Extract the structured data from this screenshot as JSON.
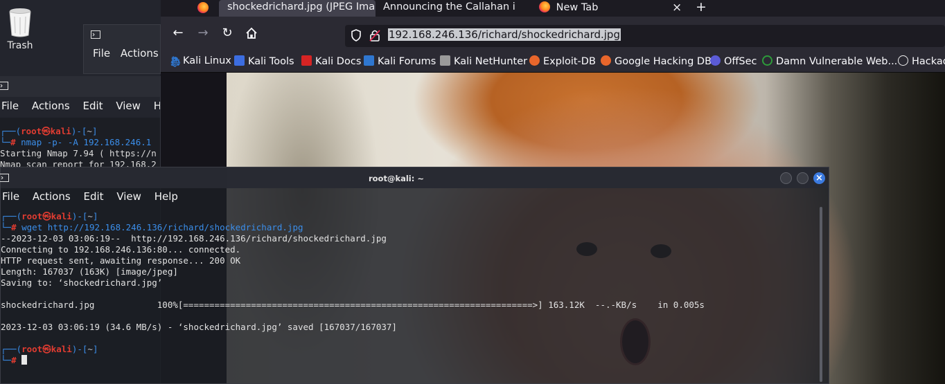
{
  "desktop": {
    "trash_label": "Trash",
    "icons": [
      "trash-icon",
      "terminal-icon",
      "firefox-icon"
    ]
  },
  "bg_terminal_top": {
    "menu": [
      "File",
      "Actions"
    ]
  },
  "bg_terminal_left": {
    "menu": [
      "File",
      "Actions",
      "Edit",
      "View",
      "Help"
    ],
    "prompt_user": "root",
    "prompt_host": "kali",
    "prompt_dir": "~",
    "command": "nmap -p- -A 192.168.246.1",
    "output": [
      "Starting Nmap 7.94 ( https://n",
      "Nmap scan report for 192.168.2"
    ]
  },
  "browser": {
    "tabs": [
      {
        "title": "shockedrichard.jpg (JPEG Ima",
        "active": true
      },
      {
        "title": "Announcing the Callahan inte",
        "active": false
      },
      {
        "title": "New Tab",
        "active": false
      }
    ],
    "url": "192.168.246.136/richard/shockedrichard.jpg",
    "bookmarks": [
      {
        "label": "Kali Linux",
        "icon": "kali-icon",
        "color": "#2f77d0"
      },
      {
        "label": "Kali Tools",
        "icon": "kali-tools-icon",
        "color": "#3c6de0"
      },
      {
        "label": "Kali Docs",
        "icon": "kali-docs-icon",
        "color": "#d62424"
      },
      {
        "label": "Kali Forums",
        "icon": "kali-forums-icon",
        "color": "#2f77d0"
      },
      {
        "label": "Kali NetHunter",
        "icon": "nethunter-icon",
        "color": "#9a9a9a"
      },
      {
        "label": "Exploit-DB",
        "icon": "exploitdb-icon",
        "color": "#e8662b"
      },
      {
        "label": "Google Hacking DB",
        "icon": "ghdb-icon",
        "color": "#e8662b"
      },
      {
        "label": "OffSec",
        "icon": "offsec-icon",
        "color": "#5b5bd6"
      },
      {
        "label": "Damn Vulnerable Web...",
        "icon": "dvwa-icon",
        "color": "#2d9b3a"
      },
      {
        "label": "Hackad",
        "icon": "globe-icon",
        "color": "#f0f0f0"
      }
    ]
  },
  "terminal": {
    "title": "root@kali: ~",
    "menu": [
      "File",
      "Actions",
      "Edit",
      "View",
      "Help"
    ],
    "prompt_user": "root",
    "prompt_host": "kali",
    "prompt_dir": "~",
    "command": "wget http://192.168.246.136/richard/shockedrichard.jpg",
    "output": [
      "--2023-12-03 03:06:19--  http://192.168.246.136/richard/shockedrichard.jpg",
      "Connecting to 192.168.246.136:80... connected.",
      "HTTP request sent, awaiting response... 200 OK",
      "Length: 167037 (163K) [image/jpeg]",
      "Saving to: ‘shockedrichard.jpg’",
      "",
      "shockedrichard.jpg            100%[===================================================================>] 163.12K  --.-KB/s    in 0.005s",
      "",
      "2023-12-03 03:06:19 (34.6 MB/s) - ‘shockedrichard.jpg’ saved [167037/167037]",
      ""
    ],
    "download_progress": 1.0
  }
}
